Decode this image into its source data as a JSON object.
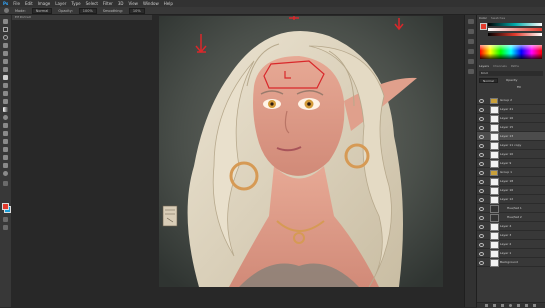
{
  "menubar": {
    "items": [
      "File",
      "Edit",
      "Image",
      "Layer",
      "Type",
      "Select",
      "Filter",
      "3D",
      "View",
      "Window",
      "Help"
    ]
  },
  "optionsbar": {
    "mode_label": "Mode:",
    "mode_value": "Normal",
    "opacity_label": "Opacity:",
    "opacity_value": "100%",
    "smoothing_label": "Smoothing:",
    "smoothing_value": "10%"
  },
  "document": {
    "tab_label": "Elf Portrait"
  },
  "panels": {
    "color_tab": "Color",
    "swatches_tab": "Swatches",
    "layers_tab": "Layers",
    "channels_tab": "Channels",
    "paths_tab": "Paths",
    "kind_label": "Kind",
    "normal_label": "Normal",
    "opacity_label": "Opacity",
    "fill_label": "Fill"
  },
  "layers": [
    {
      "name": "Group 2",
      "type": "group",
      "selected": false
    },
    {
      "name": "Layer 21",
      "type": "layer",
      "selected": false
    },
    {
      "name": "Layer 16",
      "type": "layer",
      "selected": false
    },
    {
      "name": "Layer 15",
      "type": "layer",
      "selected": false
    },
    {
      "name": "Layer 13",
      "type": "layer",
      "selected": true
    },
    {
      "name": "Layer 11 copy",
      "type": "layer",
      "selected": false
    },
    {
      "name": "Layer 10",
      "type": "layer",
      "selected": false
    },
    {
      "name": "Layer 9",
      "type": "layer",
      "selected": false
    },
    {
      "name": "Group 1",
      "type": "group",
      "selected": false
    },
    {
      "name": "Layer 18",
      "type": "layer",
      "selected": false
    },
    {
      "name": "Layer 16",
      "type": "layer",
      "selected": false
    },
    {
      "name": "Layer 12",
      "type": "layer",
      "selected": false
    },
    {
      "name": "Hue/Sat 1",
      "type": "adjust",
      "selected": false
    },
    {
      "name": "Hue/Sat 2",
      "type": "adjust",
      "selected": false
    },
    {
      "name": "Layer 4",
      "type": "layer",
      "selected": false
    },
    {
      "name": "Layer 3",
      "type": "layer",
      "selected": false
    },
    {
      "name": "Layer 2",
      "type": "layer",
      "selected": false
    },
    {
      "name": "Layer 1",
      "type": "layer",
      "selected": false
    },
    {
      "name": "Background",
      "type": "layer",
      "selected": false
    }
  ],
  "colors": {
    "foreground": "#e23a2c",
    "background": "#1c9fd9",
    "accent_blue": "#1473e6"
  },
  "icons": [
    "move-icon",
    "marquee-icon",
    "lasso-icon",
    "wand-icon",
    "crop-icon",
    "eyedropper-icon",
    "heal-icon",
    "brush-icon",
    "stamp-icon",
    "history-brush-icon",
    "eraser-icon",
    "gradient-icon",
    "blur-icon",
    "dodge-icon",
    "pen-icon",
    "type-icon",
    "path-select-icon",
    "shape-icon",
    "hand-icon",
    "zoom-icon"
  ]
}
